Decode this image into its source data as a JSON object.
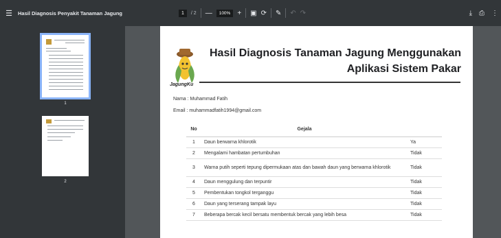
{
  "toolbar": {
    "menu_icon": "hamburger-icon",
    "title": "Hasil Diagnosis Penyakit Tanaman Jagung",
    "page_current": "1",
    "page_total": "/ 2",
    "zoom_out": "—",
    "zoom": "100%",
    "zoom_in": "+"
  },
  "sidebar": {
    "thumbnails": [
      {
        "label": "1",
        "selected": true
      },
      {
        "label": "2",
        "selected": false
      }
    ]
  },
  "document": {
    "logo_text": "JagungKu",
    "title_line1": "Hasil Diagnosis Tanaman Jagung Menggunakan",
    "title_line2": "Aplikasi Sistem Pakar",
    "name": "Nama : Muhammad Fatih",
    "email": "Email : muhammadfatih1994@gmail.com",
    "table": {
      "headers": [
        "No",
        "Gejala",
        ""
      ],
      "rows": [
        {
          "no": "1",
          "gejala": "Daun berwarna khlorotik",
          "jawab": "Ya"
        },
        {
          "no": "2",
          "gejala": "Mengalami hambatan pertumbuhan",
          "jawab": "Tidak"
        },
        {
          "no": "3",
          "gejala": "Warna putih seperti tepung dipermukaan atas dan bawah daun yang berwarna khlorotik",
          "jawab": "Tidak"
        },
        {
          "no": "4",
          "gejala": "Daun menggulung dan terpuntir",
          "jawab": "Tidak"
        },
        {
          "no": "5",
          "gejala": "Pembentukan tongkol terganggu",
          "jawab": "Tidak"
        },
        {
          "no": "6",
          "gejala": "Daun yang terserang tampak layu",
          "jawab": "Tidak"
        },
        {
          "no": "7",
          "gejala": "Beberapa bercak kecil bersatu membentuk bercak yang lebih besa",
          "jawab": "Tidak"
        }
      ]
    }
  }
}
